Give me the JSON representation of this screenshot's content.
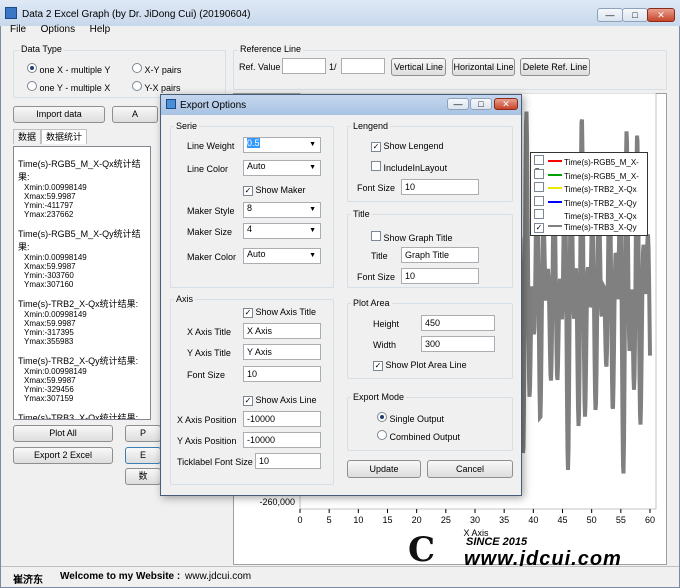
{
  "window": {
    "title": "Data 2 Excel Graph (by Dr. JiDong Cui) (20190604)",
    "min_icon": "minimize-icon",
    "max_icon": "maximize-icon",
    "close_icon": "close-icon"
  },
  "menu": [
    "File",
    "Options",
    "Help"
  ],
  "data_type": {
    "label": "Data Type",
    "options": [
      "one X  - multiple Y",
      "X-Y pairs",
      "one Y  - multiple X",
      "Y-X pairs"
    ],
    "selected": 0
  },
  "reference_line": {
    "label": "Reference Line",
    "ref_value_label": "Ref. Value",
    "fraction_label": "1/",
    "ref_value": "",
    "fraction_value": "",
    "buttons": [
      "Vertical Line",
      "Horizontal Line",
      "Delete Ref. Line"
    ]
  },
  "left_panel": {
    "import_button": "Import data",
    "hidden_button": "A",
    "tabs": [
      "数据",
      "数据统计"
    ],
    "stats": [
      {
        "title": "Time(s)-RGB5_M_X-Qx统计结果:",
        "lines": [
          "Xmin:0.00998149",
          "Xmax:59.9987",
          "Ymin:-411797",
          "Ymax:237662"
        ]
      },
      {
        "title": "Time(s)-RGB5_M_X-Qy统计结果:",
        "lines": [
          "Xmin:0.00998149",
          "Xmax:59.9987",
          "Ymin:-303760",
          "Ymax:307160"
        ]
      },
      {
        "title": "Time(s)-TRB2_X-Qx统计结果:",
        "lines": [
          "Xmin:0.00998149",
          "Xmax:59.9987",
          "Ymin:-317395",
          "Ymax:355983"
        ]
      },
      {
        "title": "Time(s)-TRB2_X-Qy统计结果:",
        "lines": [
          "Xmin:0.00998149",
          "Xmax:59.9987",
          "Ymin:-329456",
          "Ymax:307159"
        ]
      },
      {
        "title": "Time(s)-TRB3_X-Qx统计结果:",
        "lines": []
      }
    ],
    "plot_all": "Plot All",
    "p_hidden": "P",
    "export_excel": "Export 2 Excel",
    "e_hidden": "E",
    "shu_hidden": "数"
  },
  "chart_data": {
    "type": "line",
    "x_ticks": [
      "0",
      "5",
      "10",
      "15",
      "20",
      "25",
      "30",
      "35",
      "40",
      "45",
      "50",
      "55",
      "60"
    ],
    "xlabel": "X Axis",
    "visible_y_tick": "-260,000",
    "xlim": [
      0,
      60
    ],
    "series": [
      {
        "name": "Time(s)-RGB5_M_X-Qx",
        "color": "#ff0000",
        "checked": false
      },
      {
        "name": "Time(s)-RGB5_M_X-Qy",
        "color": "#00a000",
        "checked": false
      },
      {
        "name": "Time(s)-TRB2_X-Qx",
        "color": "#e8e800",
        "checked": false
      },
      {
        "name": "Time(s)-TRB2_X-Qy",
        "color": "#0000ff",
        "checked": false
      },
      {
        "name": "Time(s)-TRB3_X-Qx",
        "color": "#ffffff",
        "checked": false
      },
      {
        "name": "Time(s)-TRB3_X-Qy",
        "color": "#808080",
        "checked": true
      }
    ]
  },
  "watermark": {
    "line1": "SINCE 2015",
    "line2": "www.jdcui.com"
  },
  "status": {
    "author": "崔济东",
    "welcome": "Welcome to my Website :",
    "url": "www.jdcui.com"
  },
  "dialog": {
    "title": "Export Options",
    "serie": {
      "label": "Serie",
      "line_weight_label": "Line Weight",
      "line_weight": "0.5",
      "line_color_label": "Line Color",
      "line_color": "Auto",
      "show_maker_label": "Show Maker",
      "show_maker": true,
      "maker_style_label": "Maker Style",
      "maker_style": "8",
      "maker_size_label": "Maker Size",
      "maker_size": "4",
      "maker_color_label": "Maker Color",
      "maker_color": "Auto"
    },
    "axis": {
      "label": "Axis",
      "show_axis_title_label": "Show Axis Title",
      "show_axis_title": true,
      "x_axis_title_label": "X Axis Title",
      "x_axis_title": "X Axis",
      "y_axis_title_label": "Y Axis Title",
      "y_axis_title": "Y Axis",
      "font_size_label": "Font Size",
      "font_size": "10",
      "show_axis_line_label": "Show Axis Line",
      "show_axis_line": true,
      "x_axis_position_label": "X Axis Position",
      "x_axis_position": "-10000",
      "y_axis_position_label": "Y Axis Position",
      "y_axis_position": "-10000",
      "ticklabel_font_size_label": "Ticklabel Font Size",
      "ticklabel_font_size": "10"
    },
    "legend": {
      "label": "Lengend",
      "show_legend_label": "Show Lengend",
      "show_legend": true,
      "include_in_layout_label": "IncludeInLayout",
      "include_in_layout": false,
      "font_size_label": "Font Size",
      "font_size": "10"
    },
    "title_group": {
      "label": "Title",
      "show_graph_title_label": "Show Graph Title",
      "show_graph_title": false,
      "title_label": "Title",
      "title": "Graph Title",
      "font_size_label": "Font Size",
      "font_size": "10"
    },
    "plot_area": {
      "label": "Plot Area",
      "height_label": "Height",
      "height": "450",
      "width_label": "Width",
      "width": "300",
      "show_plot_area_line_label": "Show Plot Area Line",
      "show_plot_area_line": true
    },
    "export_mode": {
      "label": "Export Mode",
      "options": [
        "Single Output",
        "Combined Output"
      ],
      "selected": 0
    },
    "update_button": "Update",
    "cancel_button": "Cancel"
  }
}
